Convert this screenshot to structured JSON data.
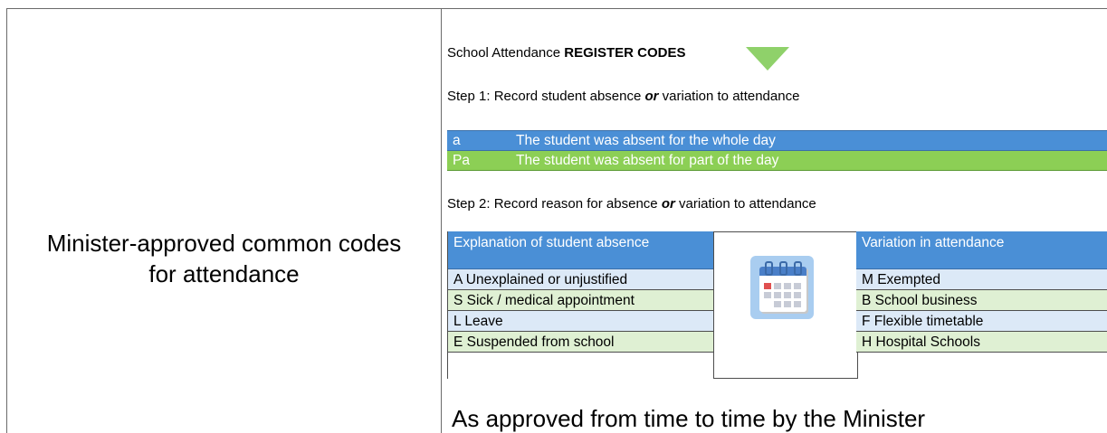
{
  "left_cell": {
    "line1": "Minister-approved common codes",
    "line2": "for attendance"
  },
  "title": {
    "prefix": "School Attendance ",
    "bold": "REGISTER CODES",
    "arrow_icon": "green-down-triangle-icon"
  },
  "step1": {
    "before": "Step 1: Record student absence ",
    "emph": "or",
    "after": " variation to attendance"
  },
  "absence_rows": [
    {
      "code": "a",
      "desc": "The student was absent for the whole day",
      "color": "#4a8fd6"
    },
    {
      "code": "Pa",
      "desc": "The student was absent for part of the day",
      "color": "#8ccf55"
    }
  ],
  "step2": {
    "before": "Step 2: Record reason for absence ",
    "emph": "or",
    "after": " variation to attendance"
  },
  "explanation": {
    "header": "Explanation of student absence",
    "rows": [
      "A  Unexplained or unjustified",
      "S  Sick / medical appointment",
      "L  Leave",
      "E  Suspended from school"
    ]
  },
  "calendar_icon": "calendar-icon",
  "variation": {
    "header": "Variation in attendance",
    "rows": [
      "M  Exempted",
      "B  School business",
      "F  Flexible timetable",
      "H  Hospital Schools"
    ]
  },
  "footer": "As approved from time to time by the Minister"
}
